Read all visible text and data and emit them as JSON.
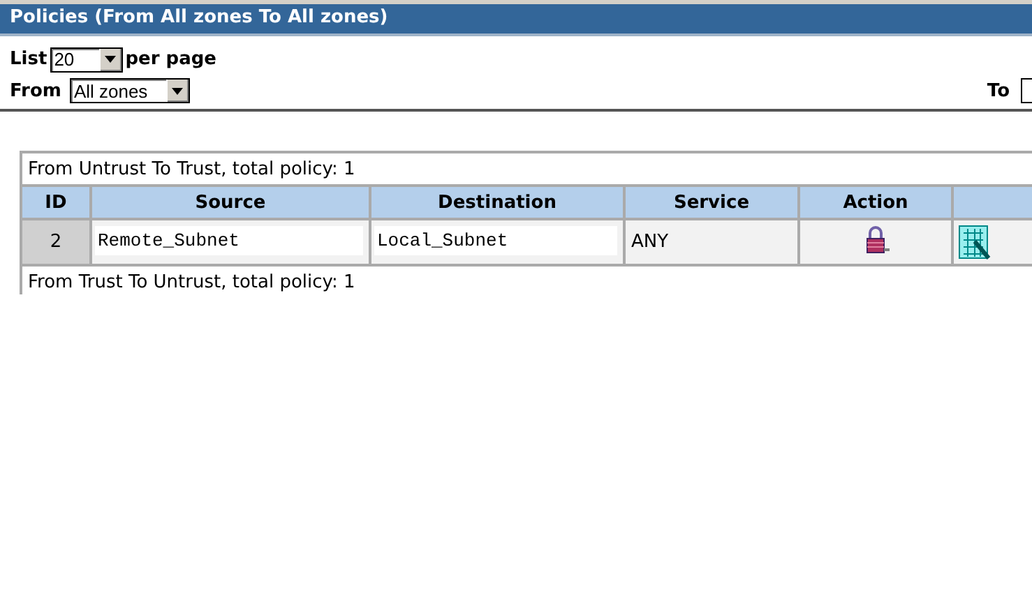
{
  "title": "Policies (From All zones To All zones)",
  "list": {
    "label": "List",
    "value": "20",
    "suffix": "per page"
  },
  "from": {
    "label": "From",
    "value": "All zones"
  },
  "to": {
    "label": "To"
  },
  "sections": [
    {
      "caption": "From Untrust To Trust, total policy: 1",
      "columns": [
        "ID",
        "Source",
        "Destination",
        "Service",
        "Action"
      ],
      "rows": [
        {
          "id": "2",
          "source": "Remote_Subnet",
          "destination": "Local_Subnet",
          "service": "ANY",
          "kind": "tunnel"
        }
      ]
    },
    {
      "caption": "From Trust To Untrust, total policy: 1"
    }
  ]
}
